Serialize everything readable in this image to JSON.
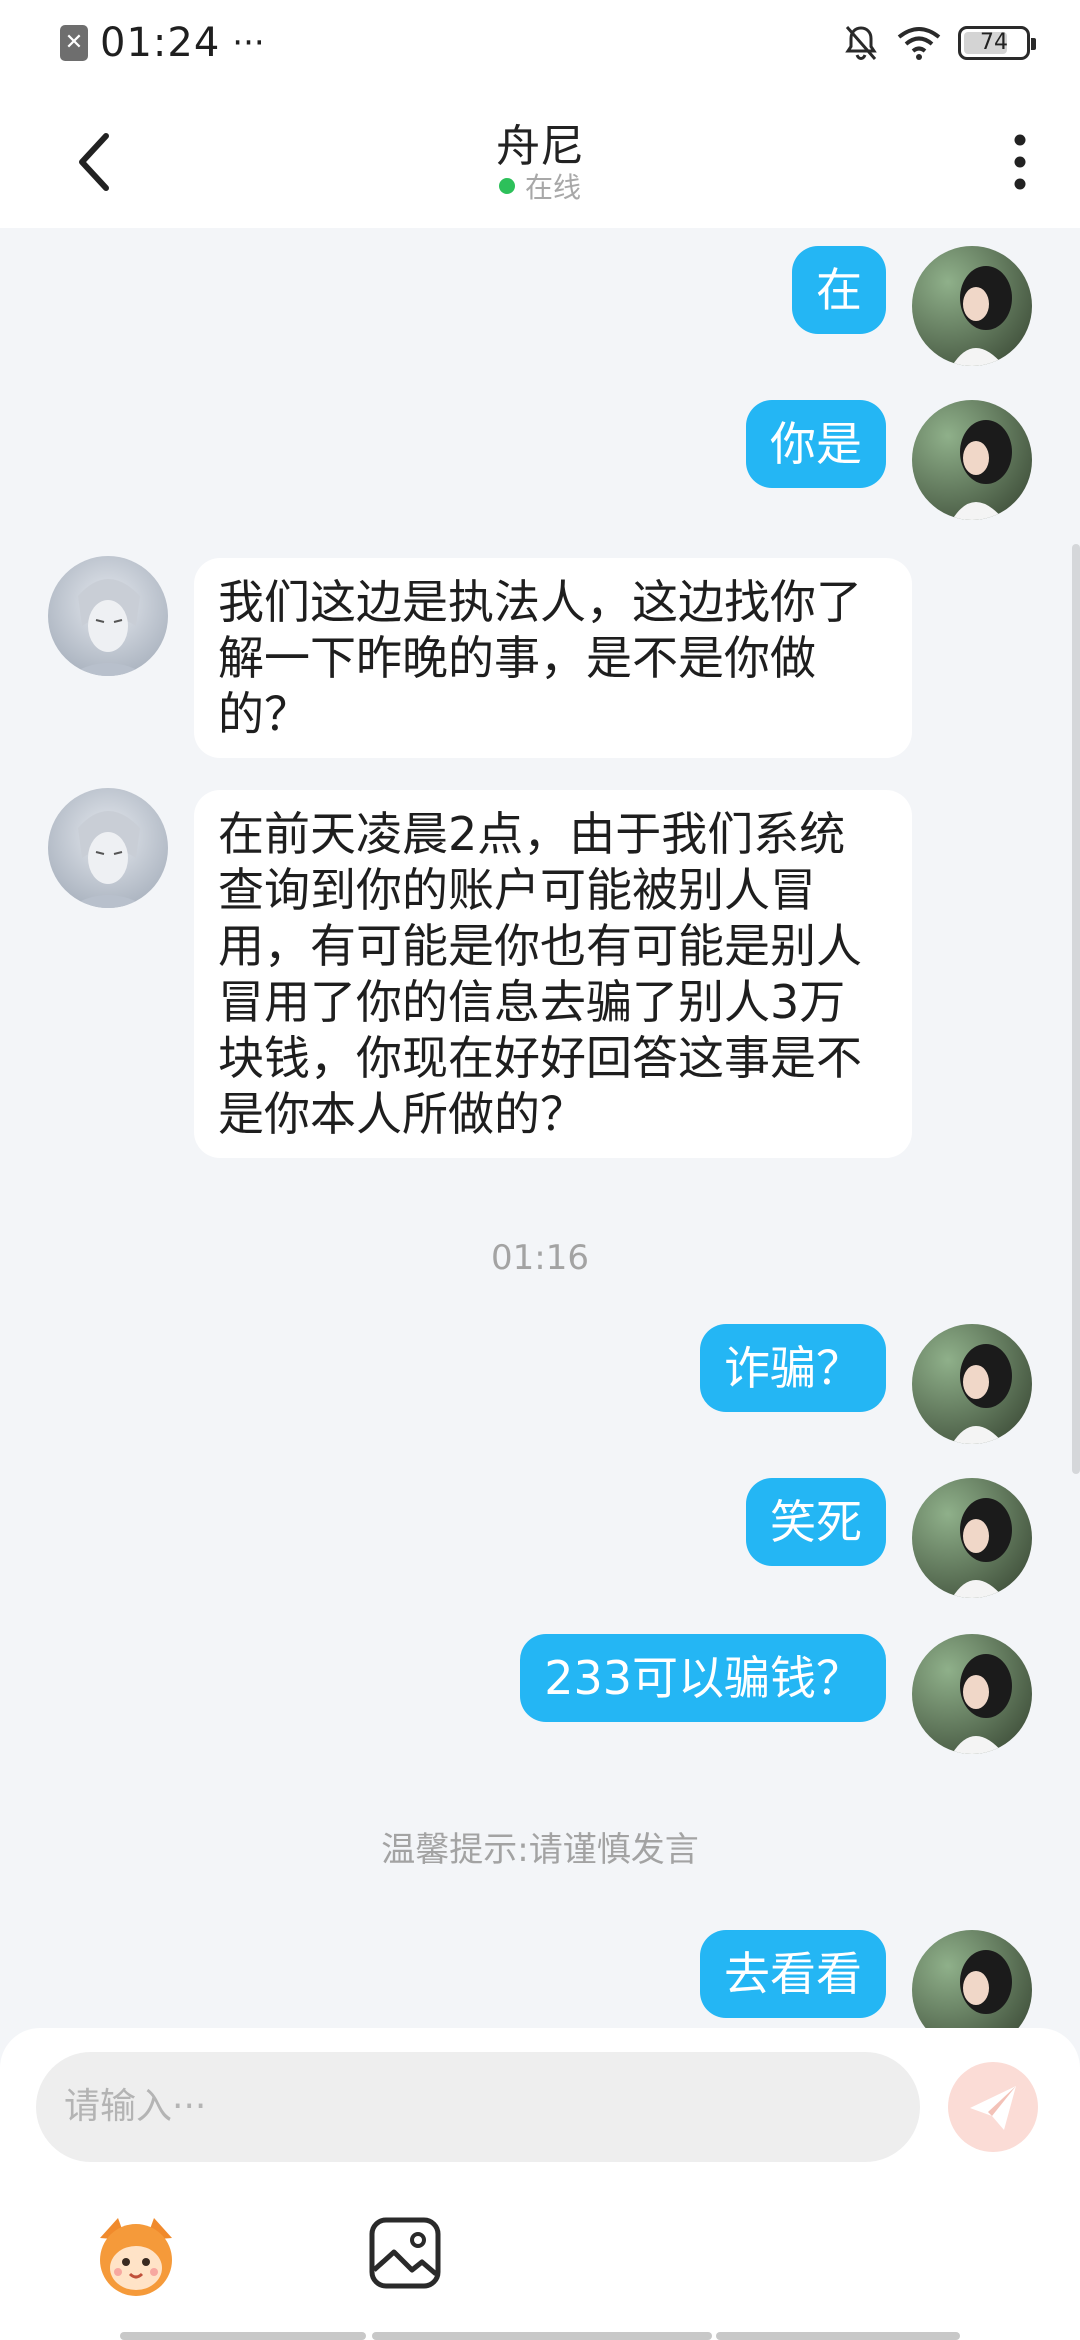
{
  "status_bar": {
    "time": "01:24",
    "more": "···",
    "battery": "74",
    "battery_level": 0.74
  },
  "header": {
    "back_icon": "chevron-left-icon",
    "name": "舟尼",
    "status": "在线",
    "more_icon": "vertical-dots-icon"
  },
  "messages": [
    {
      "side": "out",
      "text": "在"
    },
    {
      "side": "out",
      "text": "你是"
    },
    {
      "side": "in",
      "lines": [
        "我们这边是执法人，这边找你了",
        "解一下昨晚的事，是不是你做",
        "的？"
      ]
    },
    {
      "side": "in",
      "lines": [
        "在前天凌晨2点，由于我们系统",
        "查询到你的账户可能被别人冒",
        "用，有可能是你也有可能是别人",
        "冒用了你的信息去骗了别人3万",
        "块钱，你现在好好回答这事是不",
        "是你本人所做的？"
      ]
    },
    {
      "timestamp": "01:16"
    },
    {
      "side": "out",
      "text": "诈骗？"
    },
    {
      "side": "out",
      "text": "笑死"
    },
    {
      "side": "out",
      "text": "233可以骗钱？"
    },
    {
      "tip": "温馨提示:请谨慎发言"
    },
    {
      "side": "out",
      "text": "去看看"
    }
  ],
  "input": {
    "placeholder": "请输入···",
    "send_icon": "paper-plane-icon",
    "emoji_icon": "mascot-emoji-icon",
    "image_icon": "image-icon"
  },
  "colors": {
    "outgoing_bubble": "#24b6f4",
    "incoming_bubble": "#ffffff",
    "background": "#f3f5f8",
    "online_dot": "#2dc05a",
    "send_button": "#fbdcd6"
  }
}
